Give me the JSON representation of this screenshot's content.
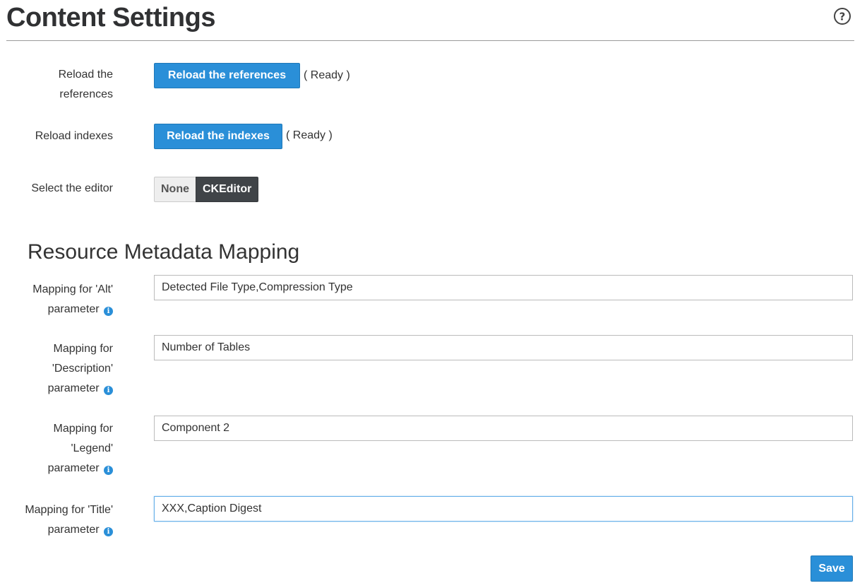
{
  "header": {
    "title": "Content Settings",
    "help_icon": "help-circle-icon"
  },
  "reload_references": {
    "label_line1": "Reload the",
    "label_line2": "references",
    "button_label": "Reload the references",
    "status": "( Ready )"
  },
  "reload_indexes": {
    "label": "Reload indexes",
    "button_label": "Reload the indexes",
    "status": "( Ready )"
  },
  "editor": {
    "label": "Select the editor",
    "options": [
      "None",
      "CKEditor"
    ],
    "selected": "CKEditor"
  },
  "metadata_mapping": {
    "heading": "Resource Metadata Mapping",
    "fields": [
      {
        "label_lines": [
          "Mapping for 'Alt'",
          "parameter"
        ],
        "value": "Detected File Type,Compression Type",
        "info_icon": "info-icon"
      },
      {
        "label_lines": [
          "Mapping for",
          "'Description'",
          "parameter"
        ],
        "value": "Number of Tables",
        "info_icon": "info-icon"
      },
      {
        "label_lines": [
          "Mapping for",
          "'Legend'",
          "parameter"
        ],
        "value": "Component 2",
        "info_icon": "info-icon"
      },
      {
        "label_lines": [
          "Mapping for 'Title'",
          "parameter"
        ],
        "value": "XXX,Caption Digest",
        "info_icon": "info-icon"
      }
    ]
  },
  "actions": {
    "save_label": "Save"
  },
  "colors": {
    "primary": "#2a8fd8",
    "toggle_active": "#404448",
    "info": "#2a8fd8"
  }
}
